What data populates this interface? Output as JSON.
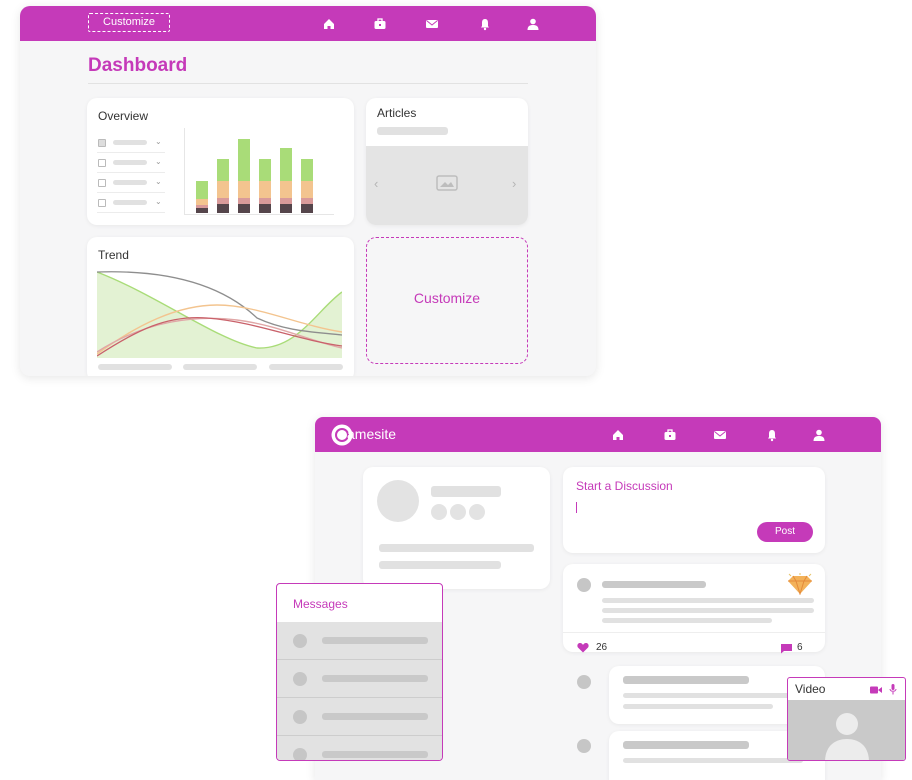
{
  "dashboard": {
    "customize_button": "Customize",
    "title": "Dashboard",
    "overview_title": "Overview",
    "articles_title": "Articles",
    "trend_title": "Trend",
    "customize_placeholder": "Customize",
    "nav_icons": [
      "home-icon",
      "briefcase-icon",
      "mail-icon",
      "bell-icon",
      "user-icon"
    ],
    "colors": {
      "brand": "#c53ab9",
      "bar_green": "#a9dc78",
      "bar_peach": "#f3c48f",
      "bar_rose": "#d99a9a",
      "bar_dark": "#55454b"
    }
  },
  "social": {
    "logo_text": "amesite",
    "discussion_title": "Start a Discussion",
    "post_button": "Post",
    "likes_count": "26",
    "comments_count": "6",
    "messages_title": "Messages",
    "video_title": "Video",
    "nav_icons": [
      "home-icon",
      "briefcase-icon",
      "mail-icon",
      "bell-icon",
      "user-icon"
    ]
  }
}
